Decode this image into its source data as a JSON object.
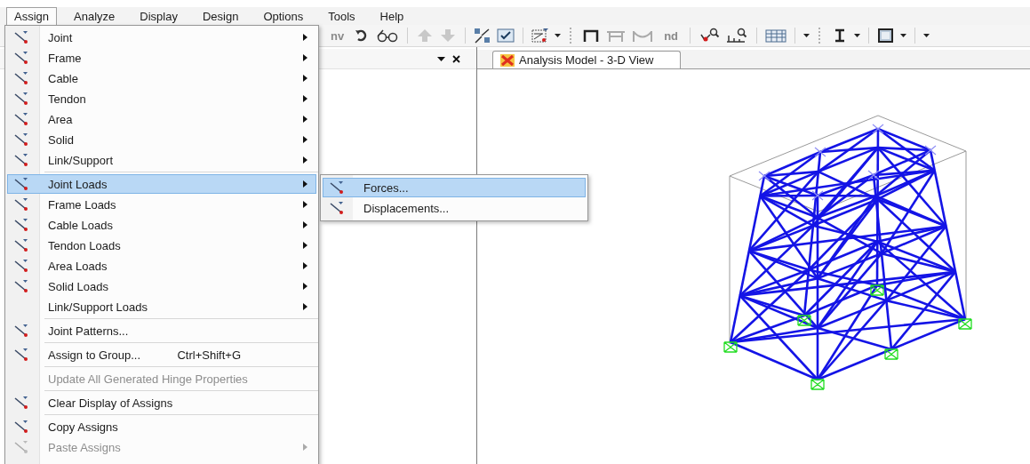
{
  "menubar": [
    {
      "label": "Assign",
      "selected": true
    },
    {
      "label": "Analyze",
      "selected": false
    },
    {
      "label": "Display",
      "selected": false
    },
    {
      "label": "Design",
      "selected": false
    },
    {
      "label": "Options",
      "selected": false
    },
    {
      "label": "Tools",
      "selected": false
    },
    {
      "label": "Help",
      "selected": false
    }
  ],
  "toolbar": {
    "labels": [
      "nv",
      "nd"
    ]
  },
  "view_tab": {
    "title": "Analysis Model - 3-D View",
    "selected": true
  },
  "menu": {
    "groups": [
      [
        {
          "label": "Joint",
          "icon": true,
          "submenu": true,
          "selected": false,
          "disabled": false
        },
        {
          "label": "Frame",
          "icon": true,
          "submenu": true,
          "selected": false,
          "disabled": false
        },
        {
          "label": "Cable",
          "icon": true,
          "submenu": true,
          "selected": false,
          "disabled": false
        },
        {
          "label": "Tendon",
          "icon": true,
          "submenu": true,
          "selected": false,
          "disabled": false
        },
        {
          "label": "Area",
          "icon": true,
          "submenu": true,
          "selected": false,
          "disabled": false
        },
        {
          "label": "Solid",
          "icon": true,
          "submenu": true,
          "selected": false,
          "disabled": false
        },
        {
          "label": "Link/Support",
          "icon": true,
          "submenu": true,
          "selected": false,
          "disabled": false
        }
      ],
      [
        {
          "label": "Joint Loads",
          "icon": true,
          "submenu": true,
          "selected": true,
          "disabled": false
        },
        {
          "label": "Frame Loads",
          "icon": true,
          "submenu": true,
          "selected": false,
          "disabled": false
        },
        {
          "label": "Cable Loads",
          "icon": true,
          "submenu": true,
          "selected": false,
          "disabled": false
        },
        {
          "label": "Tendon Loads",
          "icon": true,
          "submenu": true,
          "selected": false,
          "disabled": false
        },
        {
          "label": "Area Loads",
          "icon": true,
          "submenu": true,
          "selected": false,
          "disabled": false
        },
        {
          "label": "Solid Loads",
          "icon": true,
          "submenu": true,
          "selected": false,
          "disabled": false
        },
        {
          "label": "Link/Support Loads",
          "icon": false,
          "submenu": true,
          "selected": false,
          "disabled": false
        }
      ],
      [
        {
          "label": "Joint Patterns...",
          "icon": true,
          "submenu": false,
          "selected": false,
          "disabled": false
        }
      ],
      [
        {
          "label": "Assign to Group...",
          "icon": true,
          "submenu": false,
          "selected": false,
          "disabled": false,
          "shortcut": "Ctrl+Shift+G"
        }
      ],
      [
        {
          "label": "Update All Generated Hinge Properties",
          "icon": false,
          "submenu": false,
          "selected": false,
          "disabled": true
        }
      ],
      [
        {
          "label": "Clear Display of Assigns",
          "icon": true,
          "submenu": false,
          "selected": false,
          "disabled": false
        }
      ],
      [
        {
          "label": "Copy Assigns",
          "icon": true,
          "submenu": false,
          "selected": false,
          "disabled": false
        },
        {
          "label": "Paste Assigns",
          "icon": true,
          "submenu": true,
          "selected": false,
          "disabled": true
        }
      ]
    ]
  },
  "submenu": {
    "items": [
      {
        "label": "Forces...",
        "selected": true
      },
      {
        "label": "Displacements...",
        "selected": false
      }
    ]
  }
}
